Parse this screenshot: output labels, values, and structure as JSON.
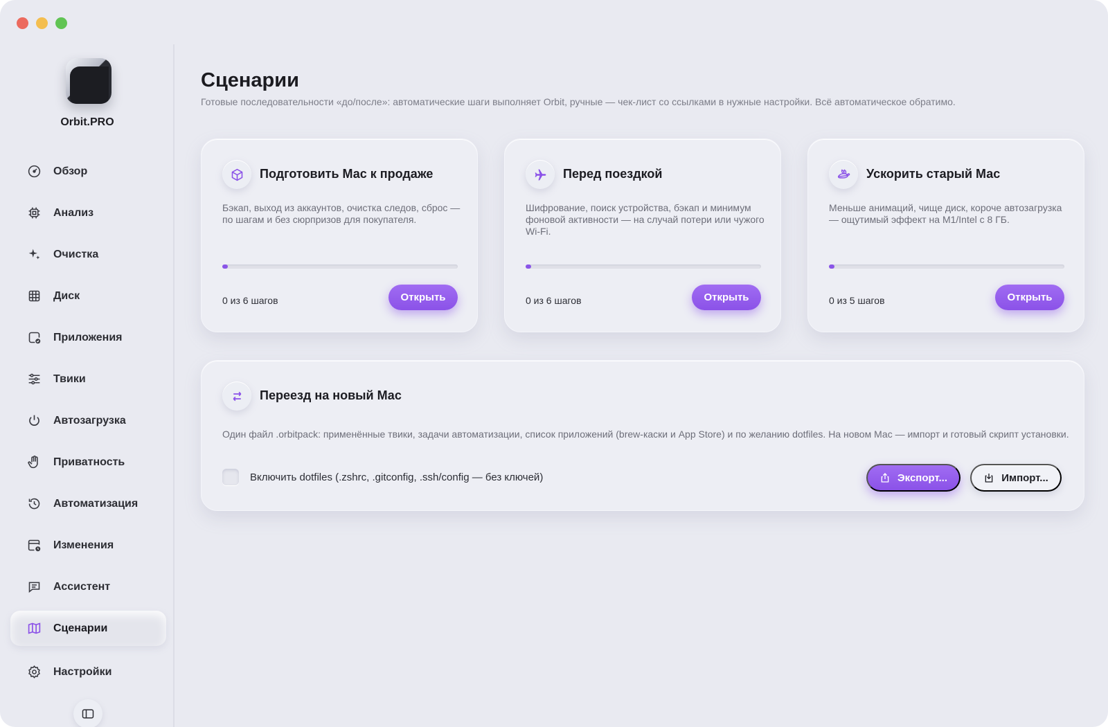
{
  "app": {
    "name": "Orbit.PRO"
  },
  "colors": {
    "accent": "#8b52e8",
    "background": "#e9eaf1",
    "text": "#1d1d22",
    "muted": "#7c7d88"
  },
  "sidebar": {
    "items": [
      {
        "label": "Обзор",
        "icon": "gauge-icon"
      },
      {
        "label": "Анализ",
        "icon": "chip-icon"
      },
      {
        "label": "Очистка",
        "icon": "sparkles-icon"
      },
      {
        "label": "Диск",
        "icon": "grid-icon"
      },
      {
        "label": "Приложения",
        "icon": "app-check-icon"
      },
      {
        "label": "Твики",
        "icon": "sliders-icon"
      },
      {
        "label": "Автозагрузка",
        "icon": "power-icon"
      },
      {
        "label": "Приватность",
        "icon": "hand-icon"
      },
      {
        "label": "Автоматизация",
        "icon": "history-icon"
      },
      {
        "label": "Изменения",
        "icon": "calendar-clock-icon"
      },
      {
        "label": "Ассистент",
        "icon": "chat-icon"
      },
      {
        "label": "Сценарии",
        "icon": "map-icon",
        "active": true
      },
      {
        "label": "Настройки",
        "icon": "gear-icon"
      }
    ]
  },
  "main": {
    "title": "Сценарии",
    "subtitle": "Готовые последовательности «до/после»: автоматические шаги выполняет Orbit, ручные — чек-лист со ссылками в нужные настройки. Всё автоматическое обратимо.",
    "scenarios": [
      {
        "title": "Подготовить Мас к продаже",
        "icon": "box-icon",
        "description": "Бэкап, выход из аккаунтов, очистка следов, сброс — по шагам и без сюрпризов для покупателя.",
        "progress": 0,
        "steps": "0 из 6 шагов",
        "button": "Открыть"
      },
      {
        "title": "Перед поездкой",
        "icon": "airplane-icon",
        "description": "Шифрование, поиск устройства, бэкап и минимум фоновой активности — на случай потери или чужого Wi-Fi.",
        "progress": 0,
        "steps": "0 из 6 шагов",
        "button": "Открыть"
      },
      {
        "title": "Ускорить старый Мас",
        "icon": "hare-icon",
        "description": "Меньше анимаций, чище диск, короче автозагрузка — ощутимый эффект на M1/Intel с 8 ГБ.",
        "progress": 0,
        "steps": "0 из 5 шагов",
        "button": "Открыть"
      }
    ],
    "migration": {
      "title": "Переезд на новый Мас",
      "icon": "arrows-swap-icon",
      "description": "Один файл .orbitpack: применённые твики, задачи автоматизации, список приложений (brew-каски и App Store) и по желанию dotfiles. На новом Мас — импорт и готовый скрипт установки.",
      "checkbox_label": "Включить dotfiles (.zshrc, .gitconfig, .ssh/config — без ключей)",
      "checkbox_checked": false,
      "export_label": "Экспорт...",
      "import_label": "Импорт..."
    }
  }
}
